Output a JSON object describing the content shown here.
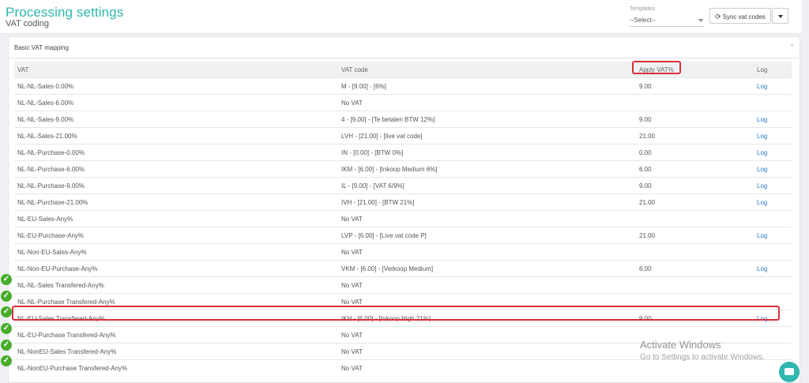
{
  "header": {
    "title": "Processing settings",
    "subtitle": "VAT coding",
    "templates_label": "Templates",
    "templates_value": "--Select--",
    "sync_label": "Sync vat codes"
  },
  "panel": {
    "title": "Basic VAT mapping",
    "collapse_icon": "chevron-up-icon"
  },
  "table": {
    "columns": [
      "VAT",
      "VAT code",
      "Apply VAT%",
      "Log"
    ],
    "rows": [
      {
        "vat": "NL-NL-Sales-0.00%",
        "code": "M - [9.00] - [6%]",
        "apply": "9.00",
        "log": "Log",
        "check": false
      },
      {
        "vat": "NL-NL-Sales-6.00%",
        "code": "No VAT",
        "apply": "",
        "log": "",
        "check": false
      },
      {
        "vat": "NL-NL-Sales-9.00%",
        "code": "4 - [9.00] - [Te betalen BTW 12%]",
        "apply": "9.00",
        "log": "Log",
        "check": false
      },
      {
        "vat": "NL-NL-Sales-21.00%",
        "code": "LVH - [21.00] - [live vat code]",
        "apply": "21.00",
        "log": "Log",
        "check": false
      },
      {
        "vat": "NL-NL-Purchase-0.00%",
        "code": "IN - [0.00] - [BTW 0%]",
        "apply": "0.00",
        "log": "Log",
        "check": false
      },
      {
        "vat": "NL-NL-Purchase-6.00%",
        "code": "IKM - [6.00] - [Inkoop Medium 6%]",
        "apply": "6.00",
        "log": "Log",
        "check": false
      },
      {
        "vat": "NL-NL-Purchase-9.00%",
        "code": "IL - [9.00] - [VAT 6/9%]",
        "apply": "9.00",
        "log": "Log",
        "check": false
      },
      {
        "vat": "NL-NL-Purchase-21.00%",
        "code": "IVH - [21.00] - [BTW 21%]",
        "apply": "21.00",
        "log": "Log",
        "check": false
      },
      {
        "vat": "NL-EU-Sales-Any%",
        "code": "No VAT",
        "apply": "",
        "log": "",
        "check": false
      },
      {
        "vat": "NL-EU-Purchase-Any%",
        "code": "LVP - [6.00] - [Live vat code P]",
        "apply": "21.00",
        "log": "Log",
        "check": false
      },
      {
        "vat": "NL-Non-EU-Sales-Any%",
        "code": "No VAT",
        "apply": "",
        "log": "",
        "check": false
      },
      {
        "vat": "NL-Non-EU-Purchase-Any%",
        "code": "VKM - [6.00] - [Verkoop Medium]",
        "apply": "6.00",
        "log": "Log",
        "check": false
      },
      {
        "vat": "NL-NL-Sales Transfered-Any%",
        "code": "No VAT",
        "apply": "",
        "log": "",
        "check": true
      },
      {
        "vat": "NL-NL-Purchase Transfered-Any%",
        "code": "No VAT",
        "apply": "",
        "log": "",
        "check": true
      },
      {
        "vat": "NL-EU-Sales Transfered-Any%",
        "code": "IKH - [6.00] - [Inkoop High 21%]",
        "apply": "9.00",
        "log": "Log",
        "check": true
      },
      {
        "vat": "NL-EU-Purchase Transfered-Any%",
        "code": "No VAT",
        "apply": "",
        "log": "",
        "check": true
      },
      {
        "vat": "NL-NonEU-Sales Transfered-Any%",
        "code": "No VAT",
        "apply": "",
        "log": "",
        "check": true
      },
      {
        "vat": "NL-NonEU-Purchase Transfered-Any%",
        "code": "No VAT",
        "apply": "",
        "log": "",
        "check": true
      }
    ]
  },
  "watermark": {
    "line1": "Activate Windows",
    "line2": "Go to Settings to activate Windows."
  },
  "colors": {
    "brand": "#2fb7b0",
    "link": "#2a78c8",
    "highlight": "#d9303a",
    "check": "#48ad2c"
  }
}
